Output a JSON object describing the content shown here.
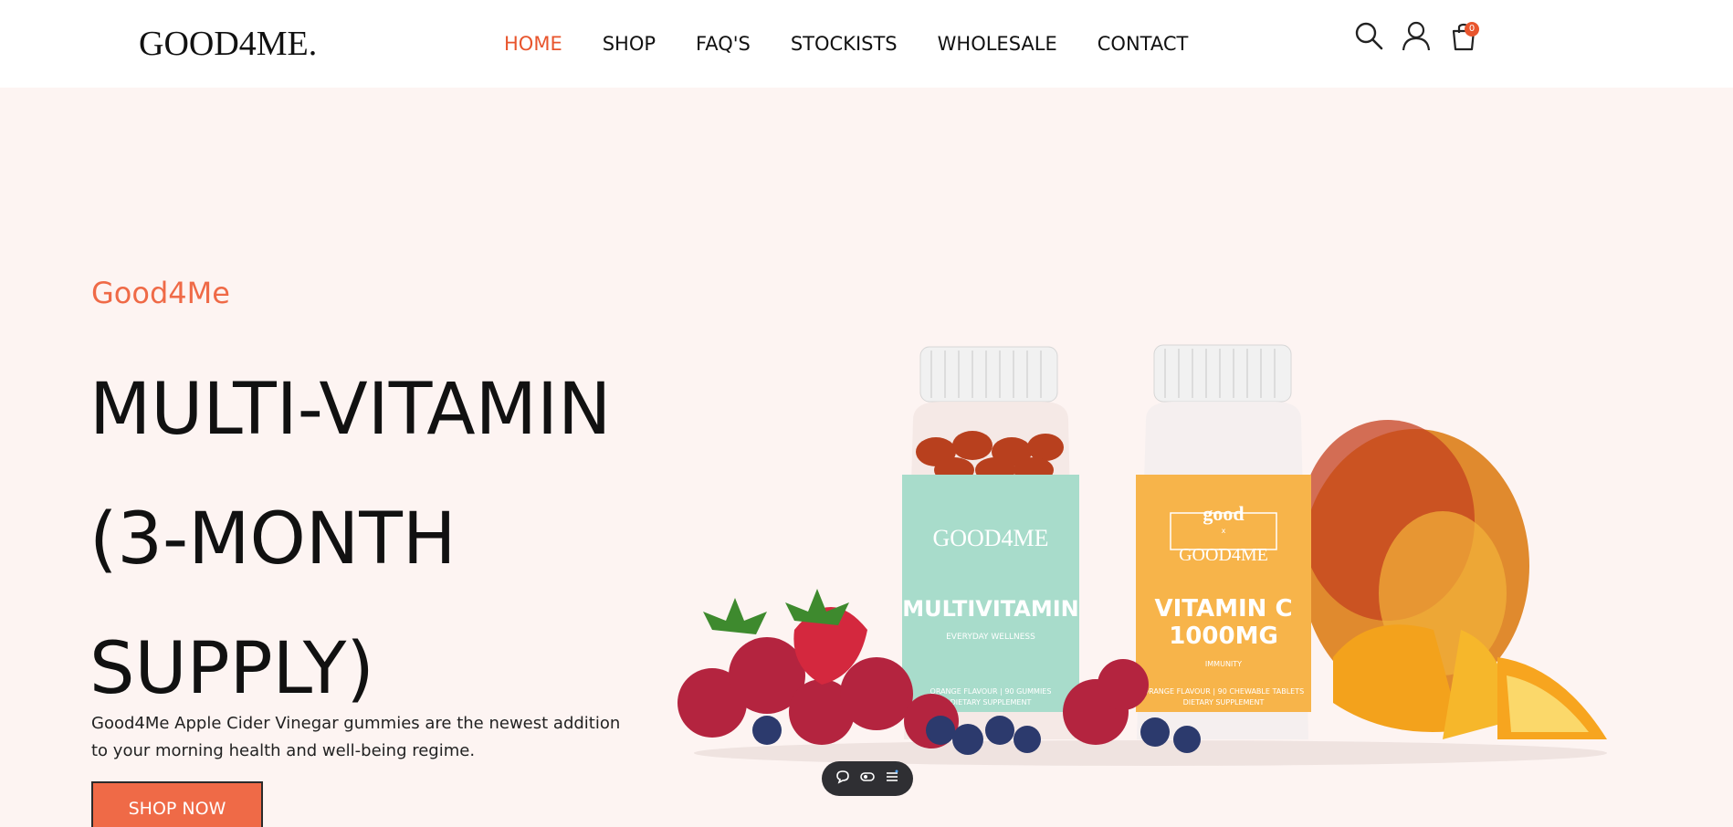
{
  "header": {
    "logo": "GOOD4ME.",
    "nav": [
      {
        "label": "HOME",
        "active": true
      },
      {
        "label": "SHOP",
        "active": false
      },
      {
        "label": "FAQ'S",
        "active": false
      },
      {
        "label": "STOCKISTS",
        "active": false
      },
      {
        "label": "WHOLESALE",
        "active": false
      },
      {
        "label": "CONTACT",
        "active": false
      }
    ],
    "icons": {
      "search": "search-icon",
      "account": "user-icon",
      "cart": "cart-icon"
    },
    "cart_count": "0"
  },
  "hero": {
    "brand": "Good4Me",
    "title_lines": [
      "MULTI-VITAMIN",
      "(3-MONTH",
      "SUPPLY)"
    ],
    "description": "Good4Me Apple Cider Vinegar gummies are the newest addition to your morning health and well-being regime.",
    "cta": "SHOP NOW",
    "product_labels": {
      "left_brand": "GOOD4ME",
      "left_name": "MULTIVITAMIN",
      "left_sub": "EVERYDAY WELLNESS",
      "left_flavour": "ORANGE FLAVOUR | 90 GUMMIES",
      "left_dietary": "DIETARY SUPPLEMENT",
      "right_top": "good",
      "right_x": "x",
      "right_brand": "GOOD4ME",
      "right_name_1": "VITAMIN C",
      "right_name_2": "1000MG",
      "right_sub": "IMMUNITY",
      "right_flavour": "ORANGE FLAVOUR | 90 CHEWABLE TABLETS",
      "right_dietary": "DIETARY SUPPLEMENT"
    }
  },
  "colors": {
    "accent": "#e8552d",
    "hero_bg": "#fdf4f2",
    "button": "#ef6a47"
  },
  "floating_toolbar": {
    "icons": [
      "comment-icon",
      "toggle-icon",
      "menu-icon"
    ]
  }
}
